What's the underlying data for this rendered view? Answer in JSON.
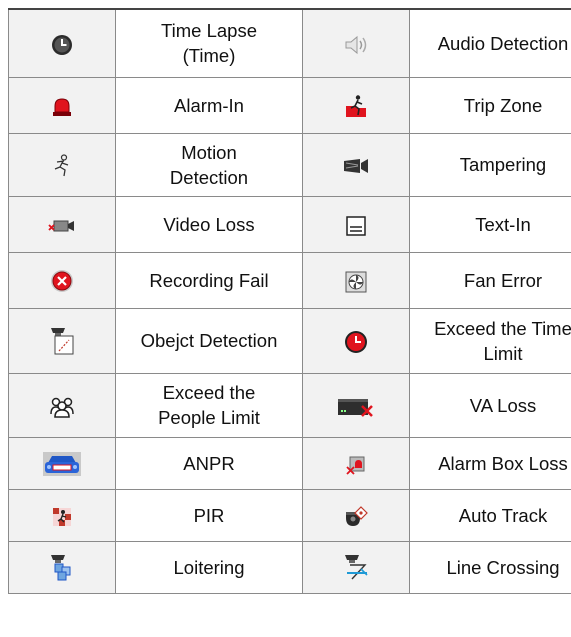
{
  "rows": [
    {
      "left": {
        "icon": "time-lapse-icon",
        "label": "Time Lapse\n(Time)"
      },
      "right": {
        "icon": "audio-detection-icon",
        "label": "Audio Detection"
      }
    },
    {
      "left": {
        "icon": "alarm-in-icon",
        "label": "Alarm-In"
      },
      "right": {
        "icon": "trip-zone-icon",
        "label": "Trip Zone"
      }
    },
    {
      "left": {
        "icon": "motion-detection-icon",
        "label": "Motion\nDetection"
      },
      "right": {
        "icon": "tampering-icon",
        "label": "Tampering"
      }
    },
    {
      "left": {
        "icon": "video-loss-icon",
        "label": "Video Loss"
      },
      "right": {
        "icon": "text-in-icon",
        "label": "Text-In"
      }
    },
    {
      "left": {
        "icon": "recording-fail-icon",
        "label": "Recording Fail"
      },
      "right": {
        "icon": "fan-error-icon",
        "label": "Fan Error"
      }
    },
    {
      "left": {
        "icon": "object-detection-icon",
        "label": "Obejct Detection"
      },
      "right": {
        "icon": "exceed-time-limit-icon",
        "label": "Exceed the Time\nLimit"
      }
    },
    {
      "left": {
        "icon": "exceed-people-limit-icon",
        "label": "Exceed the\nPeople Limit"
      },
      "right": {
        "icon": "va-loss-icon",
        "label": "VA Loss"
      }
    },
    {
      "left": {
        "icon": "anpr-icon",
        "label": "ANPR"
      },
      "right": {
        "icon": "alarm-box-loss-icon",
        "label": "Alarm Box Loss"
      }
    },
    {
      "left": {
        "icon": "pir-icon",
        "label": "PIR"
      },
      "right": {
        "icon": "auto-track-icon",
        "label": "Auto Track"
      }
    },
    {
      "left": {
        "icon": "loitering-icon",
        "label": "Loitering"
      },
      "right": {
        "icon": "line-crossing-icon",
        "label": "Line Crossing"
      }
    }
  ],
  "colors": {
    "alarm_red": "#e0141e",
    "icon_dark": "#333333",
    "header_rule": "#444444",
    "icon_cell_bg": "#f2f2f2"
  }
}
